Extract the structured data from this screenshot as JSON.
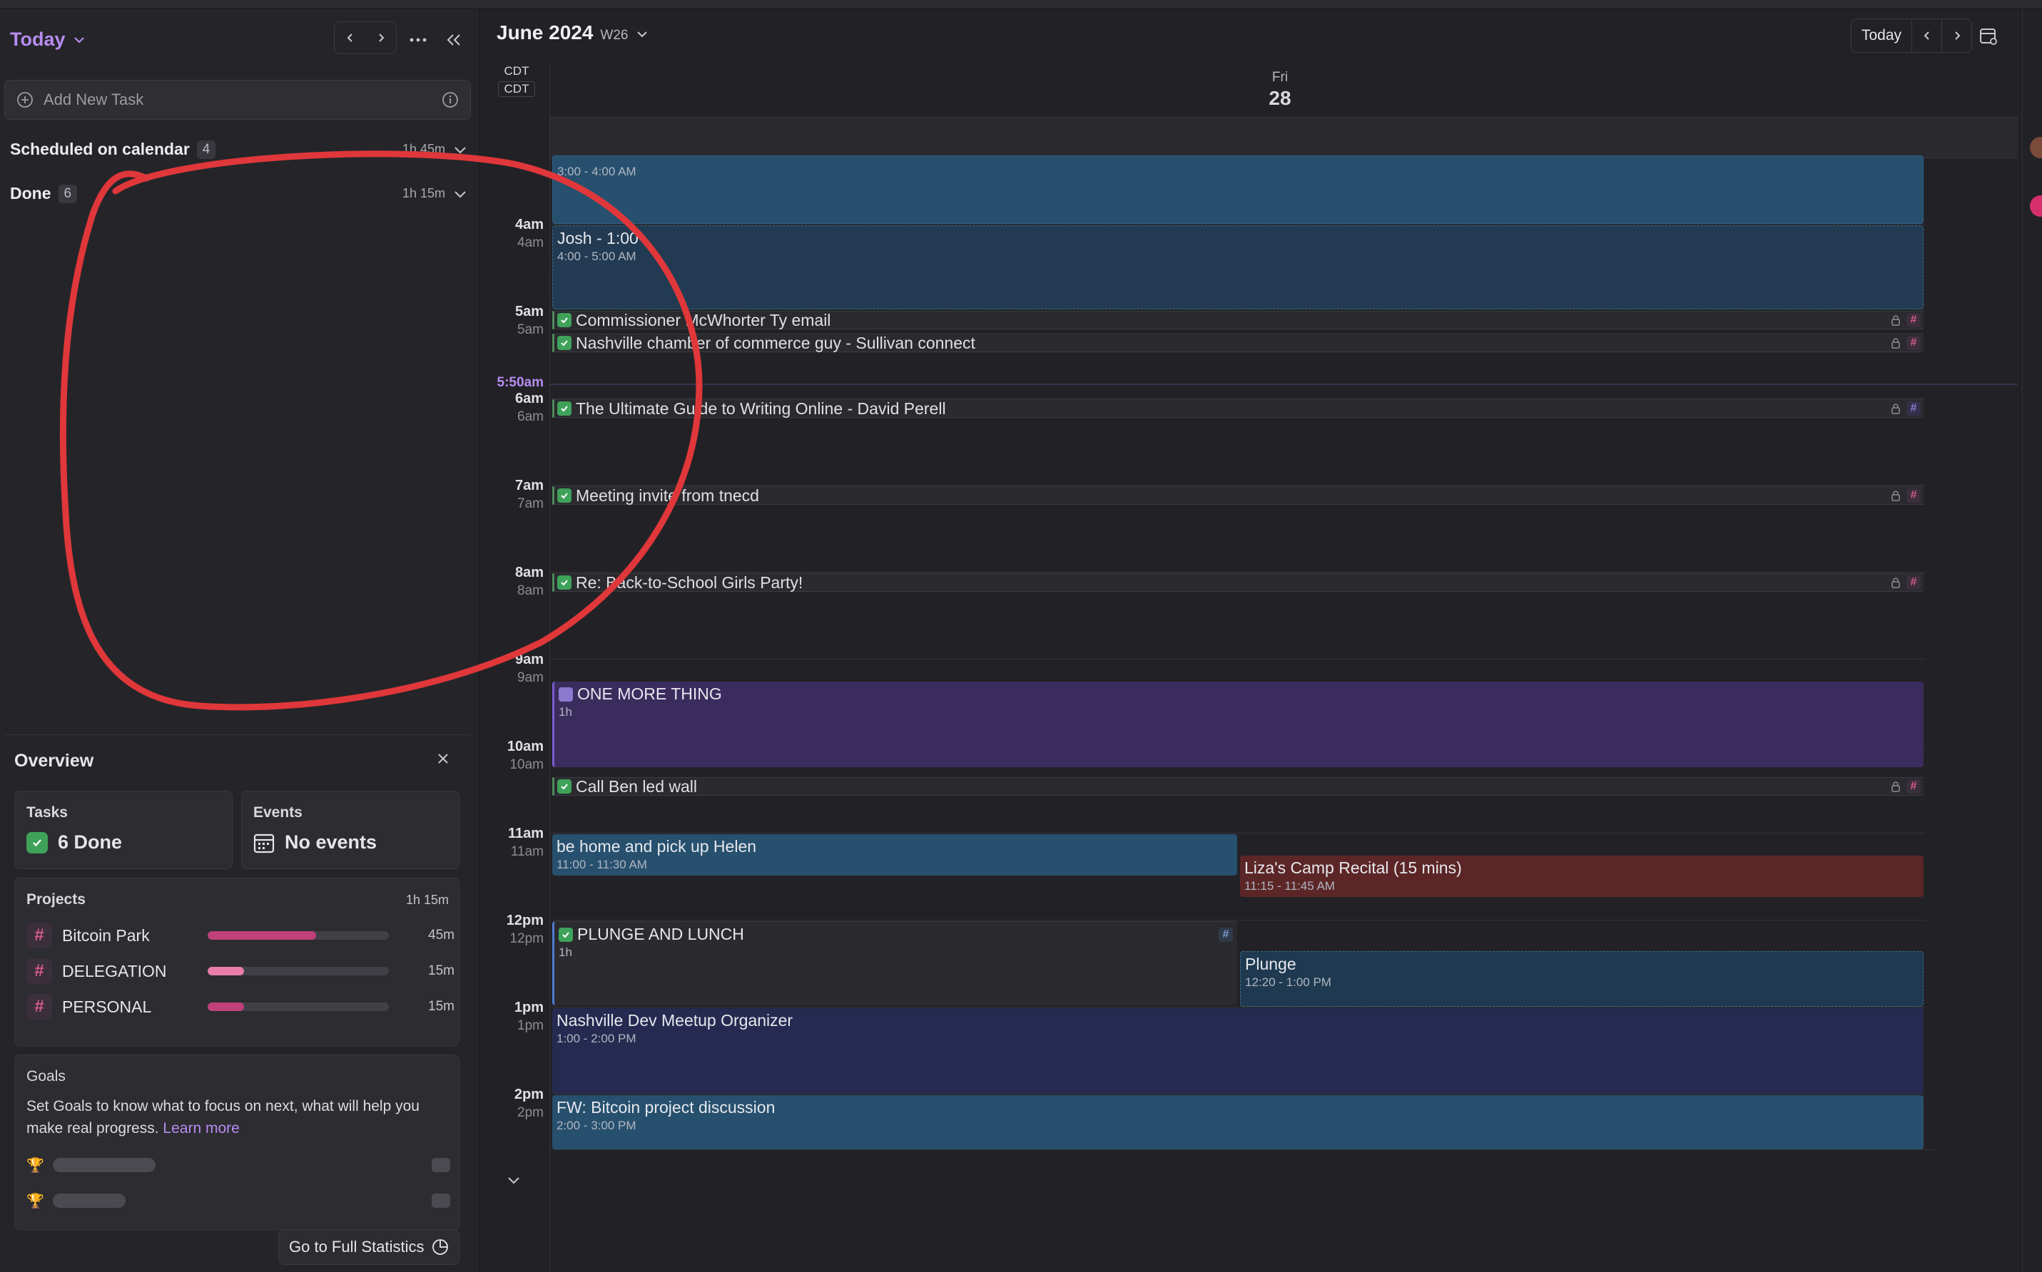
{
  "sidebar": {
    "title": "Today",
    "add_task_placeholder": "Add New Task",
    "groups": [
      {
        "label": "Scheduled on calendar",
        "count": "4",
        "duration": "1h 45m"
      },
      {
        "label": "Done",
        "count": "6",
        "duration": "1h 15m"
      }
    ]
  },
  "overview": {
    "title": "Overview",
    "tasks_label": "Tasks",
    "tasks_value": "6 Done",
    "events_label": "Events",
    "events_value": "No events",
    "projects_label": "Projects",
    "projects_total": "1h 15m",
    "projects": [
      {
        "name": "Bitcoin Park",
        "duration": "45m",
        "fraction": 0.6,
        "color": "#c0407a"
      },
      {
        "name": "DELEGATION",
        "duration": "15m",
        "fraction": 0.2,
        "color": "#e87ea8"
      },
      {
        "name": "PERSONAL",
        "duration": "15m",
        "fraction": 0.2,
        "color": "#c0407a"
      }
    ],
    "goals_label": "Goals",
    "goals_text": "Set Goals to know what to focus on next, what will help you make real progress.",
    "goals_link": "Learn more",
    "full_stats": "Go to Full Statistics"
  },
  "calendar": {
    "month": "June 2024",
    "week": "W26",
    "today_btn": "Today",
    "tz1": "CDT",
    "tz2": "CDT",
    "day_name": "Fri",
    "day_num": "28",
    "now_label": "5:50am",
    "hours": [
      {
        "a": "4am",
        "b": "4am"
      },
      {
        "a": "5am",
        "b": "5am"
      },
      {
        "a": "6am",
        "b": "6am"
      },
      {
        "a": "7am",
        "b": "7am"
      },
      {
        "a": "8am",
        "b": "8am"
      },
      {
        "a": "9am",
        "b": "9am"
      },
      {
        "a": "10am",
        "b": "10am"
      },
      {
        "a": "11am",
        "b": "11am"
      },
      {
        "a": "12pm",
        "b": "12pm"
      },
      {
        "a": "1pm",
        "b": "1pm"
      },
      {
        "a": "2pm",
        "b": "2pm"
      }
    ],
    "events": {
      "e0": {
        "time": "3:00 - 4:00 AM"
      },
      "e1": {
        "title": "Josh - 1:00",
        "time": "4:00 - 5:00 AM"
      },
      "omt": {
        "title": "ONE MORE THING",
        "time": "1h"
      },
      "helen": {
        "title": "be home and pick up Helen",
        "time": "11:00 - 11:30 AM"
      },
      "liza": {
        "title": "Liza's Camp Recital (15 mins)",
        "time": "11:15 - 11:45 AM"
      },
      "plunge_lunch": {
        "title": "PLUNGE AND LUNCH",
        "time": "1h"
      },
      "plunge": {
        "title": "Plunge",
        "time": "12:20 - 1:00 PM"
      },
      "meetup": {
        "title": "Nashville Dev Meetup Organizer",
        "time": "1:00 - 2:00 PM"
      },
      "bitcoin": {
        "title": "FW: Bitcoin project discussion",
        "time": "2:00 - 3:00 PM"
      }
    },
    "tasks": [
      "Commissioner McWhorter Ty email",
      "Nashville chamber of commerce guy - Sullivan connect",
      "The Ultimate Guide to Writing Online - David Perell",
      "Meeting invite from tnecd",
      "Re: Back-to-School Girls Party!",
      "Call Ben led wall"
    ]
  }
}
